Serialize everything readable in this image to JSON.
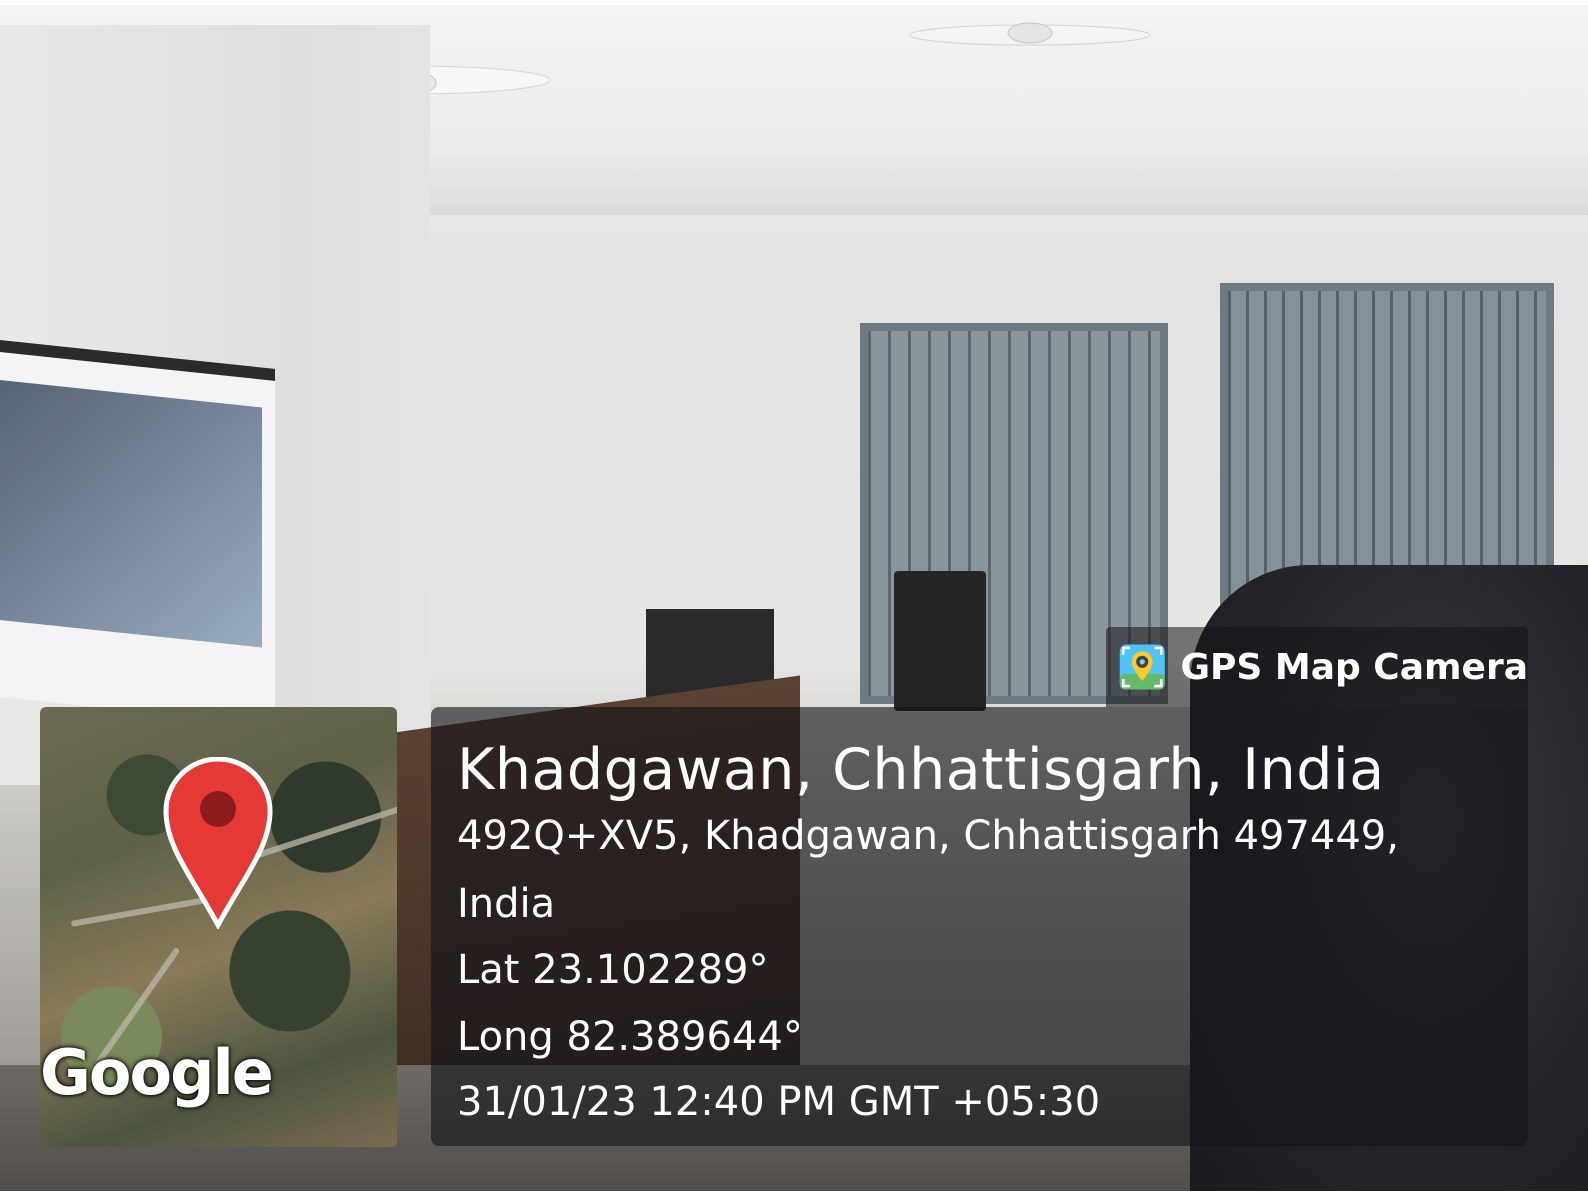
{
  "gps_tag": {
    "app_name": "GPS Map Camera",
    "icon": "gps-map-camera-app-icon"
  },
  "map": {
    "logo_text": "Google",
    "pin_icon": "map-pin-icon",
    "pin_color": "#e53935"
  },
  "location": {
    "place": "Khadgawan, Chhattisgarh, India",
    "address_line1": "492Q+XV5, Khadgawan, Chhattisgarh 497449,",
    "address_line2": "India",
    "latitude": "Lat 23.102289°",
    "longitude": "Long 82.389644°",
    "datetime": "31/01/23 12:40 PM GMT +05:30"
  }
}
